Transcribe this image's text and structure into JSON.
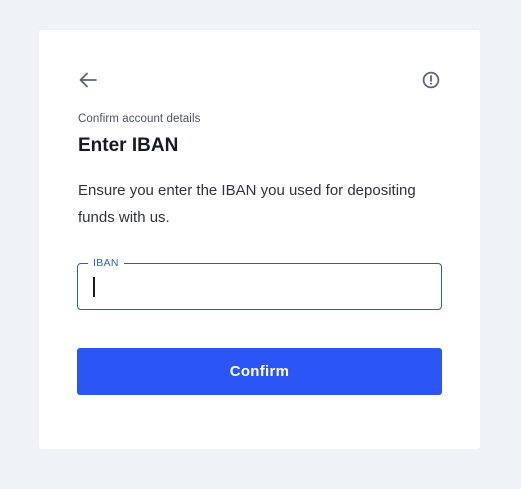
{
  "header": {
    "back_icon": "arrow-left-icon",
    "info_icon": "info-circle-icon"
  },
  "content": {
    "eyebrow": "Confirm account details",
    "title": "Enter IBAN",
    "description": "Ensure you enter the IBAN you used for depositing funds with us."
  },
  "form": {
    "iban_label": "IBAN",
    "iban_value": "",
    "iban_placeholder": ""
  },
  "actions": {
    "confirm_label": "Confirm"
  },
  "colors": {
    "background": "#eff2f7",
    "card": "#ffffff",
    "accent": "#2b55f5",
    "field_border": "#2a62a8",
    "field_label": "#2a5cc8",
    "icon": "#5c6575"
  }
}
